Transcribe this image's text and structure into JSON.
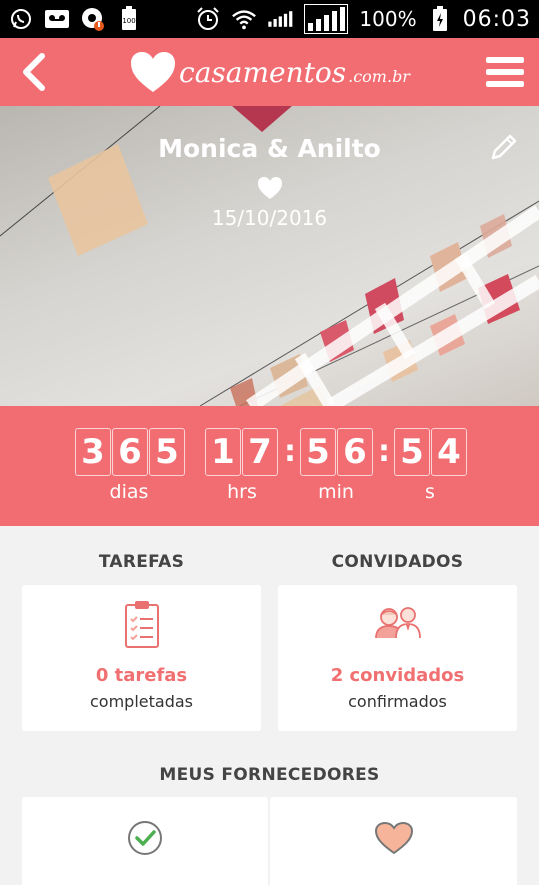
{
  "status_bar": {
    "battery_percent": "100%",
    "time": "06:03",
    "left_icons": [
      "whatsapp-icon",
      "voicemail-icon",
      "notification-alert-icon",
      "battery-saver-icon"
    ],
    "right_icons": [
      "alarm-icon",
      "wifi-icon",
      "signal-icon",
      "signal-icon",
      "battery-charging-icon"
    ]
  },
  "app_bar": {
    "logo_word": "casamentos",
    "logo_tld": ".com.br"
  },
  "hero": {
    "couple": "Monica & Anilto",
    "date": "15/10/2016"
  },
  "countdown": {
    "days": [
      "3",
      "6",
      "5"
    ],
    "hours": [
      "1",
      "7"
    ],
    "minutes": [
      "5",
      "6"
    ],
    "seconds": [
      "5",
      "4"
    ],
    "labels": {
      "days": "dias",
      "hours": "hrs",
      "minutes": "min",
      "seconds": "s"
    },
    "separator": ":"
  },
  "tasks": {
    "title": "TAREFAS",
    "value": "0 tarefas",
    "sub": "completadas"
  },
  "guests": {
    "title": "CONVIDADOS",
    "value": "2 convidados",
    "sub": "confirmados"
  },
  "vendors": {
    "title": "MEUS FORNECEDORES"
  },
  "colors": {
    "brand": "#f26d72",
    "accent_text": "#f07072",
    "background": "#f2f2f2"
  }
}
